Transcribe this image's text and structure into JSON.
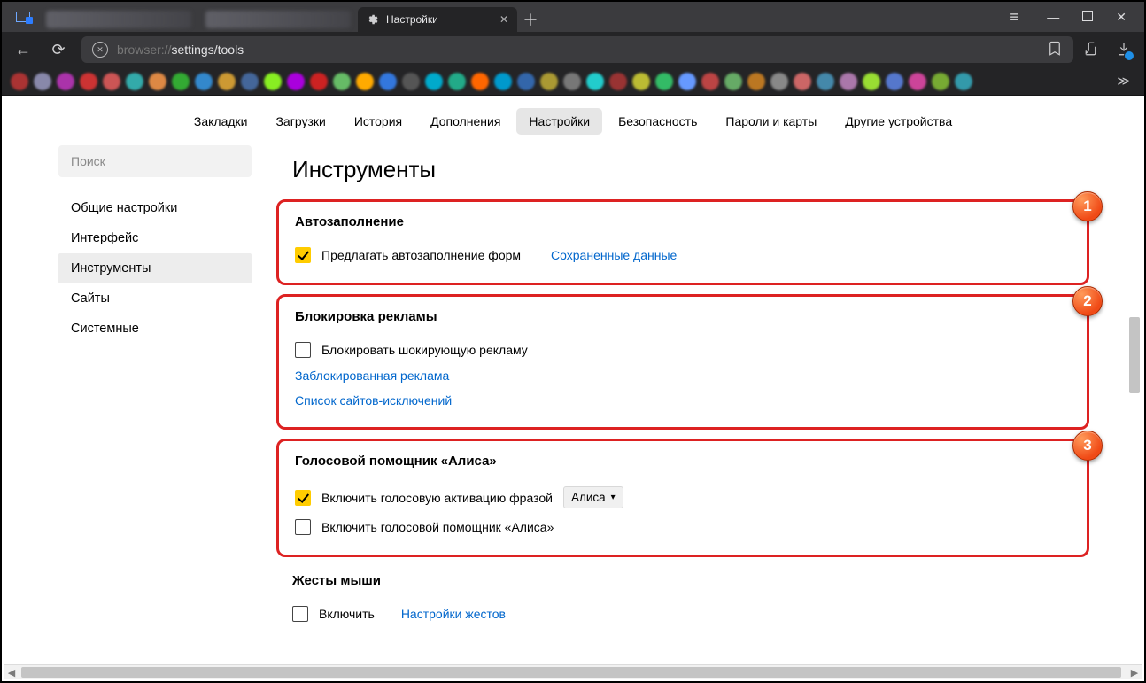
{
  "window": {
    "tab_title": "Настройки",
    "new_tab_glyph": "＋"
  },
  "url": {
    "scheme": "browser",
    "separator": "://",
    "path": "settings/tools"
  },
  "top_tabs": {
    "items": [
      {
        "label": "Закладки"
      },
      {
        "label": "Загрузки"
      },
      {
        "label": "История"
      },
      {
        "label": "Дополнения"
      },
      {
        "label": "Настройки"
      },
      {
        "label": "Безопасность"
      },
      {
        "label": "Пароли и карты"
      },
      {
        "label": "Другие устройства"
      }
    ],
    "active_index": 4
  },
  "sidebar": {
    "search_placeholder": "Поиск",
    "items": [
      {
        "label": "Общие настройки"
      },
      {
        "label": "Интерфейс"
      },
      {
        "label": "Инструменты"
      },
      {
        "label": "Сайты"
      },
      {
        "label": "Системные"
      }
    ],
    "active_index": 2
  },
  "main": {
    "title": "Инструменты",
    "sections": {
      "s1": {
        "badge": "1",
        "heading": "Автозаполнение",
        "cb1_label": "Предлагать автозаполнение форм",
        "link1": "Сохраненные данные"
      },
      "s2": {
        "badge": "2",
        "heading": "Блокировка рекламы",
        "cb1_label": "Блокировать шокирующую рекламу",
        "link1": "Заблокированная реклама",
        "link2": "Список сайтов-исключений"
      },
      "s3": {
        "badge": "3",
        "heading": "Голосовой помощник «Алиса»",
        "cb1_label": "Включить голосовую активацию фразой",
        "select_value": "Алиса",
        "cb2_label": "Включить голосовой помощник «Алиса»"
      },
      "s4": {
        "heading": "Жесты мыши",
        "cb1_label": "Включить",
        "link1": "Настройки жестов"
      }
    }
  },
  "bookmark_colors": [
    "#a33",
    "#88a",
    "#a3a",
    "#c33",
    "#c55",
    "#3aa",
    "#d84",
    "#3a3",
    "#38c",
    "#c93",
    "#469",
    "#8e2",
    "#a0d",
    "#c22",
    "#6b6",
    "#fa0",
    "#37d",
    "#555",
    "#0ac",
    "#2a8",
    "#f60",
    "#09c",
    "#36a",
    "#a93",
    "#777",
    "#2cc",
    "#933",
    "#bb3",
    "#3b6",
    "#69f",
    "#b44",
    "#6a6",
    "#b72",
    "#888",
    "#c66",
    "#48a",
    "#a7a",
    "#9d3",
    "#57c",
    "#c49",
    "#7a3",
    "#39a"
  ]
}
